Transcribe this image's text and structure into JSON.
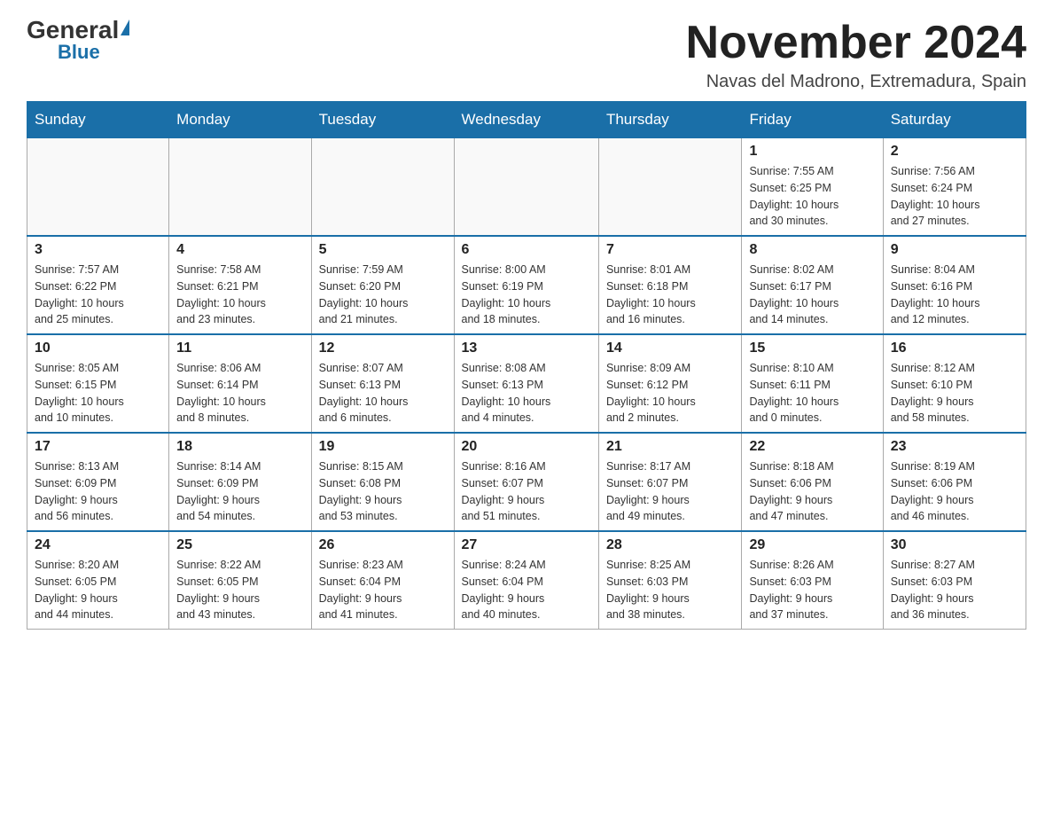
{
  "logo": {
    "general": "General",
    "blue": "Blue"
  },
  "title": "November 2024",
  "location": "Navas del Madrono, Extremadura, Spain",
  "weekdays": [
    "Sunday",
    "Monday",
    "Tuesday",
    "Wednesday",
    "Thursday",
    "Friday",
    "Saturday"
  ],
  "weeks": [
    [
      {
        "day": "",
        "info": ""
      },
      {
        "day": "",
        "info": ""
      },
      {
        "day": "",
        "info": ""
      },
      {
        "day": "",
        "info": ""
      },
      {
        "day": "",
        "info": ""
      },
      {
        "day": "1",
        "info": "Sunrise: 7:55 AM\nSunset: 6:25 PM\nDaylight: 10 hours\nand 30 minutes."
      },
      {
        "day": "2",
        "info": "Sunrise: 7:56 AM\nSunset: 6:24 PM\nDaylight: 10 hours\nand 27 minutes."
      }
    ],
    [
      {
        "day": "3",
        "info": "Sunrise: 7:57 AM\nSunset: 6:22 PM\nDaylight: 10 hours\nand 25 minutes."
      },
      {
        "day": "4",
        "info": "Sunrise: 7:58 AM\nSunset: 6:21 PM\nDaylight: 10 hours\nand 23 minutes."
      },
      {
        "day": "5",
        "info": "Sunrise: 7:59 AM\nSunset: 6:20 PM\nDaylight: 10 hours\nand 21 minutes."
      },
      {
        "day": "6",
        "info": "Sunrise: 8:00 AM\nSunset: 6:19 PM\nDaylight: 10 hours\nand 18 minutes."
      },
      {
        "day": "7",
        "info": "Sunrise: 8:01 AM\nSunset: 6:18 PM\nDaylight: 10 hours\nand 16 minutes."
      },
      {
        "day": "8",
        "info": "Sunrise: 8:02 AM\nSunset: 6:17 PM\nDaylight: 10 hours\nand 14 minutes."
      },
      {
        "day": "9",
        "info": "Sunrise: 8:04 AM\nSunset: 6:16 PM\nDaylight: 10 hours\nand 12 minutes."
      }
    ],
    [
      {
        "day": "10",
        "info": "Sunrise: 8:05 AM\nSunset: 6:15 PM\nDaylight: 10 hours\nand 10 minutes."
      },
      {
        "day": "11",
        "info": "Sunrise: 8:06 AM\nSunset: 6:14 PM\nDaylight: 10 hours\nand 8 minutes."
      },
      {
        "day": "12",
        "info": "Sunrise: 8:07 AM\nSunset: 6:13 PM\nDaylight: 10 hours\nand 6 minutes."
      },
      {
        "day": "13",
        "info": "Sunrise: 8:08 AM\nSunset: 6:13 PM\nDaylight: 10 hours\nand 4 minutes."
      },
      {
        "day": "14",
        "info": "Sunrise: 8:09 AM\nSunset: 6:12 PM\nDaylight: 10 hours\nand 2 minutes."
      },
      {
        "day": "15",
        "info": "Sunrise: 8:10 AM\nSunset: 6:11 PM\nDaylight: 10 hours\nand 0 minutes."
      },
      {
        "day": "16",
        "info": "Sunrise: 8:12 AM\nSunset: 6:10 PM\nDaylight: 9 hours\nand 58 minutes."
      }
    ],
    [
      {
        "day": "17",
        "info": "Sunrise: 8:13 AM\nSunset: 6:09 PM\nDaylight: 9 hours\nand 56 minutes."
      },
      {
        "day": "18",
        "info": "Sunrise: 8:14 AM\nSunset: 6:09 PM\nDaylight: 9 hours\nand 54 minutes."
      },
      {
        "day": "19",
        "info": "Sunrise: 8:15 AM\nSunset: 6:08 PM\nDaylight: 9 hours\nand 53 minutes."
      },
      {
        "day": "20",
        "info": "Sunrise: 8:16 AM\nSunset: 6:07 PM\nDaylight: 9 hours\nand 51 minutes."
      },
      {
        "day": "21",
        "info": "Sunrise: 8:17 AM\nSunset: 6:07 PM\nDaylight: 9 hours\nand 49 minutes."
      },
      {
        "day": "22",
        "info": "Sunrise: 8:18 AM\nSunset: 6:06 PM\nDaylight: 9 hours\nand 47 minutes."
      },
      {
        "day": "23",
        "info": "Sunrise: 8:19 AM\nSunset: 6:06 PM\nDaylight: 9 hours\nand 46 minutes."
      }
    ],
    [
      {
        "day": "24",
        "info": "Sunrise: 8:20 AM\nSunset: 6:05 PM\nDaylight: 9 hours\nand 44 minutes."
      },
      {
        "day": "25",
        "info": "Sunrise: 8:22 AM\nSunset: 6:05 PM\nDaylight: 9 hours\nand 43 minutes."
      },
      {
        "day": "26",
        "info": "Sunrise: 8:23 AM\nSunset: 6:04 PM\nDaylight: 9 hours\nand 41 minutes."
      },
      {
        "day": "27",
        "info": "Sunrise: 8:24 AM\nSunset: 6:04 PM\nDaylight: 9 hours\nand 40 minutes."
      },
      {
        "day": "28",
        "info": "Sunrise: 8:25 AM\nSunset: 6:03 PM\nDaylight: 9 hours\nand 38 minutes."
      },
      {
        "day": "29",
        "info": "Sunrise: 8:26 AM\nSunset: 6:03 PM\nDaylight: 9 hours\nand 37 minutes."
      },
      {
        "day": "30",
        "info": "Sunrise: 8:27 AM\nSunset: 6:03 PM\nDaylight: 9 hours\nand 36 minutes."
      }
    ]
  ]
}
